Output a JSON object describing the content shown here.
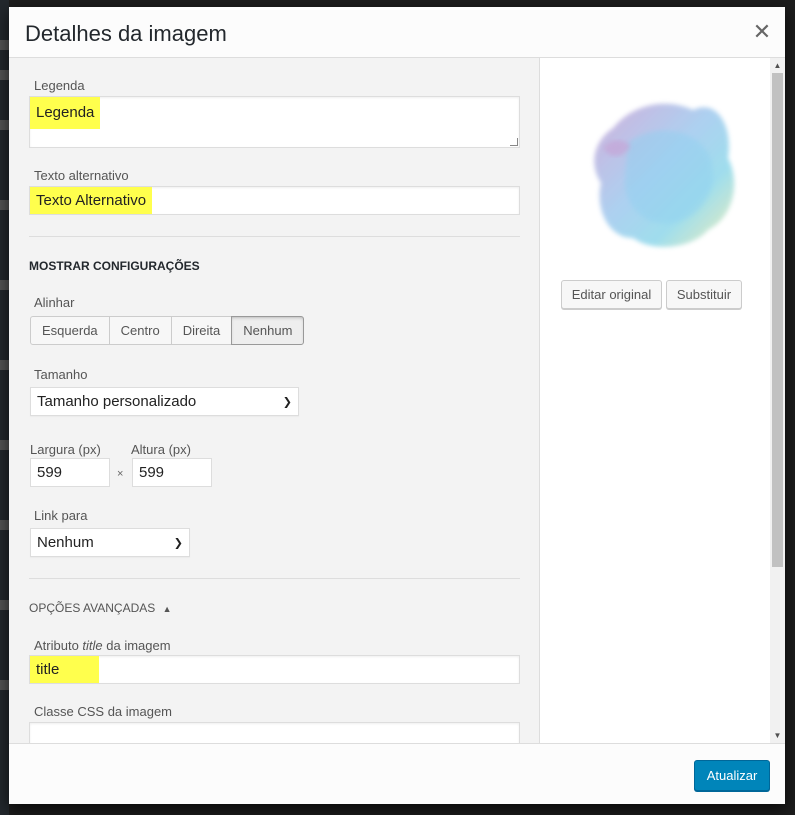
{
  "modal": {
    "title": "Detalhes da imagem",
    "close_icon": "close-icon"
  },
  "fields": {
    "caption_label": "Legenda",
    "caption_value": "Legenda",
    "alt_label": "Texto alternativo",
    "alt_value": "Texto Alternativo"
  },
  "display_settings": {
    "heading": "MOSTRAR CONFIGURAÇÕES",
    "align_label": "Alinhar",
    "align_options": [
      "Esquerda",
      "Centro",
      "Direita",
      "Nenhum"
    ],
    "align_selected": "Nenhum",
    "size_label": "Tamanho",
    "size_value": "Tamanho personalizado",
    "width_label": "Largura (px)",
    "width_value": "599",
    "height_label": "Altura (px)",
    "height_value": "599",
    "times_symbol": "×",
    "link_label": "Link para",
    "link_value": "Nenhum"
  },
  "advanced": {
    "heading": "OPÇÕES AVANÇADAS",
    "toggle_symbol": "▲",
    "title_label_prefix": "Atributo ",
    "title_label_em": "title",
    "title_label_suffix": " da imagem",
    "title_value": "title",
    "css_label": "Classe CSS da imagem",
    "css_value": ""
  },
  "thumbnail": {
    "edit_button": "Editar original",
    "replace_button": "Substituir"
  },
  "footer": {
    "update_button": "Atualizar"
  },
  "colors": {
    "highlight": "#ffff4d",
    "primary": "#0085ba"
  }
}
